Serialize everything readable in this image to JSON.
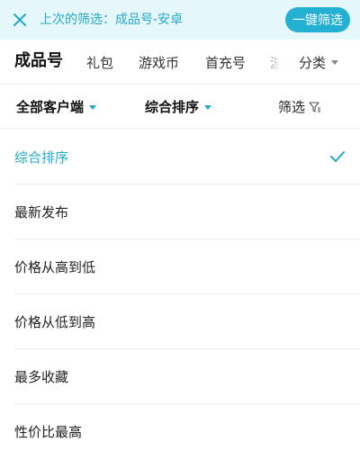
{
  "banner": {
    "text": "上次的筛选：成品号-安卓",
    "apply_label": "一键筛选",
    "accent": "#23b0d3"
  },
  "tabs": [
    {
      "label": "成品号",
      "active": true
    },
    {
      "label": "礼包",
      "active": false
    },
    {
      "label": "游戏币",
      "active": false
    },
    {
      "label": "首充号",
      "active": false
    },
    {
      "label": "游",
      "active": false
    }
  ],
  "category": {
    "label": "分类"
  },
  "filters": {
    "client": "全部客户端",
    "sort": "综合排序",
    "filter": "筛选"
  },
  "sort_options": [
    {
      "label": "综合排序",
      "selected": true
    },
    {
      "label": "最新发布",
      "selected": false
    },
    {
      "label": "价格从高到低",
      "selected": false
    },
    {
      "label": "价格从低到高",
      "selected": false
    },
    {
      "label": "最多收藏",
      "selected": false
    },
    {
      "label": "性价比最高",
      "selected": false
    }
  ],
  "icons": {
    "close": "close-icon",
    "check": "check-icon",
    "funnel": "funnel-icon",
    "caret": "caret-down-icon"
  },
  "colors": {
    "accent_text": "#23a9c9",
    "banner_bg": "#e6f7fb"
  }
}
